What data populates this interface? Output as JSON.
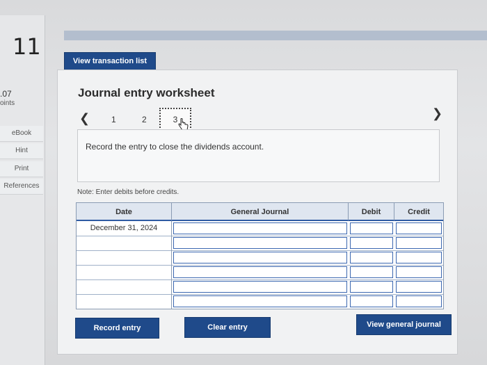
{
  "question": {
    "number": "11",
    "score": ".07",
    "points_label": "oints"
  },
  "sidebar": {
    "items": [
      {
        "label": "eBook"
      },
      {
        "label": "Hint"
      },
      {
        "label": "Print"
      },
      {
        "label": "References"
      }
    ]
  },
  "toolbar": {
    "view_transaction_list": "View transaction list"
  },
  "worksheet": {
    "title": "Journal entry worksheet",
    "pages": [
      "1",
      "2",
      "3"
    ],
    "current_page": "3",
    "instruction": "Record the entry to close the dividends account.",
    "note": "Note: Enter debits before credits."
  },
  "table": {
    "headers": {
      "date": "Date",
      "general_journal": "General Journal",
      "debit": "Debit",
      "credit": "Credit"
    },
    "rows": [
      {
        "date": "December 31, 2024"
      },
      {
        "date": ""
      },
      {
        "date": ""
      },
      {
        "date": ""
      },
      {
        "date": ""
      },
      {
        "date": ""
      }
    ]
  },
  "buttons": {
    "record_entry": "Record entry",
    "clear_entry": "Clear entry",
    "view_general_journal": "View general journal"
  },
  "colors": {
    "primary_button": "#1f4a8a",
    "input_border": "#3b67b0"
  },
  "icons": {
    "cursor": "hand-pointer-icon",
    "prev": "chevron-left-icon",
    "next": "chevron-right-icon"
  }
}
